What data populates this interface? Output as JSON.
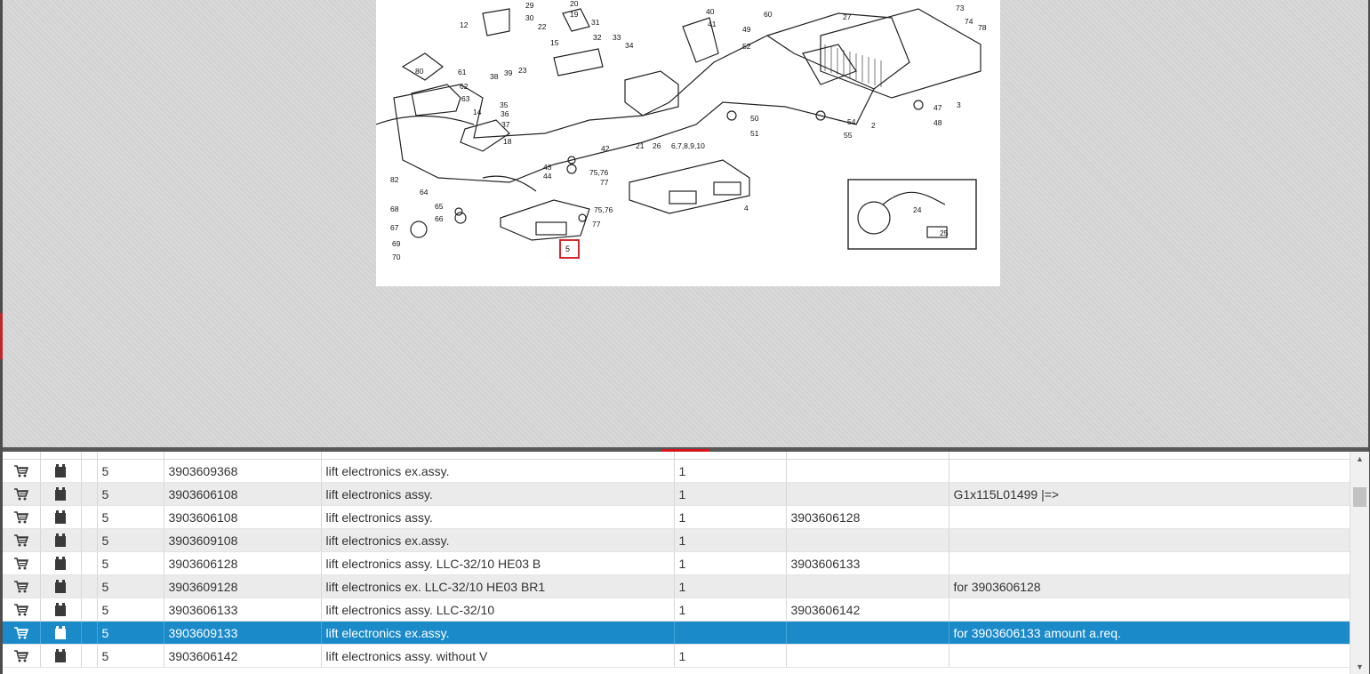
{
  "diagram": {
    "highlighted_callout": "5",
    "callouts": [
      "29",
      "30",
      "20",
      "19",
      "12",
      "31",
      "32",
      "22",
      "15",
      "33",
      "34",
      "40",
      "41",
      "60",
      "27",
      "73",
      "74",
      "78",
      "49",
      "52",
      "80",
      "61",
      "62",
      "63",
      "38",
      "39",
      "23",
      "14",
      "35",
      "36",
      "37",
      "18",
      "21",
      "26",
      "6,7,8,9,10",
      "50",
      "51",
      "47",
      "48",
      "3",
      "2",
      "54",
      "55",
      "42",
      "43",
      "44",
      "75,76",
      "77",
      "82",
      "64",
      "68",
      "65",
      "66",
      "67",
      "69",
      "70",
      "4",
      "24",
      "25"
    ]
  },
  "table": {
    "rows": [
      {
        "pos": "5",
        "part_no": "3903609368",
        "description": "lift electronics ex.assy.",
        "qty": "1",
        "replaced_by": "",
        "remark": ""
      },
      {
        "pos": "5",
        "part_no": "3903606108",
        "description": "lift electronics assy.",
        "qty": "1",
        "replaced_by": "",
        "remark": "G1x115L01499 |=>"
      },
      {
        "pos": "5",
        "part_no": "3903606108",
        "description": "lift electronics assy.",
        "qty": "1",
        "replaced_by": "3903606128",
        "remark": ""
      },
      {
        "pos": "5",
        "part_no": "3903609108",
        "description": "lift electronics ex.assy.",
        "qty": "1",
        "replaced_by": "",
        "remark": ""
      },
      {
        "pos": "5",
        "part_no": "3903606128",
        "description": "lift electronics assy. LLC-32/10 HE03 B",
        "qty": "1",
        "replaced_by": "3903606133",
        "remark": ""
      },
      {
        "pos": "5",
        "part_no": "3903609128",
        "description": "lift electronics ex. LLC-32/10 HE03 BR1",
        "qty": "1",
        "replaced_by": "",
        "remark": "for 3903606128"
      },
      {
        "pos": "5",
        "part_no": "3903606133",
        "description": "lift electronics assy. LLC-32/10",
        "qty": "1",
        "replaced_by": "3903606142",
        "remark": ""
      },
      {
        "pos": "5",
        "part_no": "3903609133",
        "description": "lift electronics ex.assy.",
        "qty": "",
        "replaced_by": "",
        "remark": "for 3903606133 amount a.req."
      },
      {
        "pos": "5",
        "part_no": "3903606142",
        "description": "lift electronics assy. without V",
        "qty": "1",
        "replaced_by": "",
        "remark": ""
      }
    ]
  },
  "colors": {
    "selected_row": "#1a8ac9",
    "accent_red": "#d5161b"
  }
}
